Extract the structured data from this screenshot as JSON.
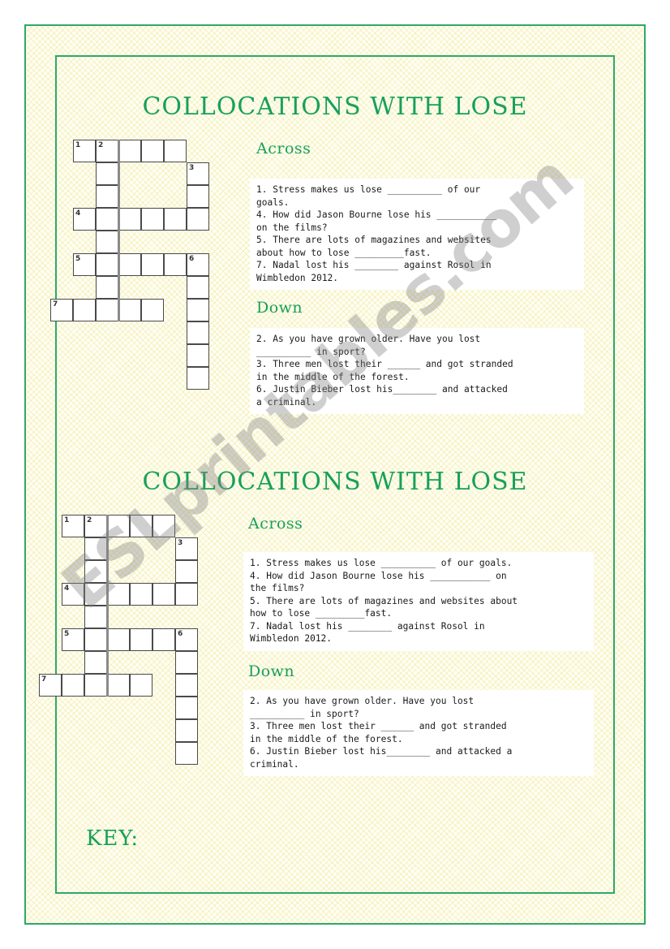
{
  "page": {
    "accent_color": "#18a05a",
    "border_color": "#2fa86b",
    "background_color": "#fffef5",
    "watermark_text": "ESLprintables.com",
    "key_label": "KEY:"
  },
  "worksheet": {
    "title": "COLLOCATIONS WITH LOSE",
    "across_heading": "Across",
    "down_heading": "Down",
    "across_clues_narrow": "1. Stress makes us lose __________ of our\ngoals.\n4. How did Jason Bourne lose his ___________\non the films?\n5. There are lots of magazines and websites\nabout how to lose _________fast.\n7. Nadal lost his ________ against Rosol in\nWimbledon 2012.",
    "down_clues_narrow": "2. As you have grown older. Have you lost\n__________ in sport?\n3. Three men lost their ______ and got stranded\nin the middle of the forest.\n6. Justin Bieber lost his________ and attacked\na criminal.",
    "across_clues_wide": "1. Stress makes us lose __________ of our goals.\n4. How did Jason Bourne lose his ___________ on\nthe films?\n5. There are lots of magazines and websites about\nhow to lose _________fast.\n7. Nadal lost his ________ against Rosol in\nWimbledon 2012.",
    "down_clues_wide": "2. As you have grown older. Have you lost\n__________ in sport?\n3. Three men lost their ______ and got stranded\nin the middle of the forest.\n6. Justin Bieber lost his________ and attacked a\ncriminal.",
    "across_items": [
      {
        "number": "1",
        "text": "Stress makes us lose __________ of our goals."
      },
      {
        "number": "4",
        "text": "How did Jason Bourne lose his ___________ on the films?"
      },
      {
        "number": "5",
        "text": "There are lots of magazines and websites about how to lose _________fast."
      },
      {
        "number": "7",
        "text": "Nadal lost his ________ against Rosol in Wimbledon 2012."
      }
    ],
    "down_items": [
      {
        "number": "2",
        "text": "As you have grown older. Have you lost __________ in sport?"
      },
      {
        "number": "3",
        "text": "Three men lost their ______ and got stranded in the middle of the forest."
      },
      {
        "number": "6",
        "text": "Justin Bieber lost his________ and attacked a criminal."
      }
    ]
  },
  "crossword": {
    "cell_size": 28,
    "columns": 8,
    "rows": 11,
    "numbers": {
      "n1": "1",
      "n2": "2",
      "n3": "3",
      "n4": "4",
      "n5": "5",
      "n6": "6",
      "n7": "7"
    },
    "cells": [
      {
        "col": 1,
        "row": 0,
        "label": "1"
      },
      {
        "col": 2,
        "row": 0,
        "label": "2"
      },
      {
        "col": 3,
        "row": 0,
        "label": ""
      },
      {
        "col": 4,
        "row": 0,
        "label": ""
      },
      {
        "col": 5,
        "row": 0,
        "label": ""
      },
      {
        "col": 2,
        "row": 1,
        "label": ""
      },
      {
        "col": 6,
        "row": 1,
        "label": "3"
      },
      {
        "col": 2,
        "row": 2,
        "label": ""
      },
      {
        "col": 6,
        "row": 2,
        "label": ""
      },
      {
        "col": 1,
        "row": 3,
        "label": "4"
      },
      {
        "col": 2,
        "row": 3,
        "label": ""
      },
      {
        "col": 3,
        "row": 3,
        "label": ""
      },
      {
        "col": 4,
        "row": 3,
        "label": ""
      },
      {
        "col": 5,
        "row": 3,
        "label": ""
      },
      {
        "col": 6,
        "row": 3,
        "label": ""
      },
      {
        "col": 2,
        "row": 4,
        "label": ""
      },
      {
        "col": 1,
        "row": 5,
        "label": "5"
      },
      {
        "col": 2,
        "row": 5,
        "label": ""
      },
      {
        "col": 3,
        "row": 5,
        "label": ""
      },
      {
        "col": 4,
        "row": 5,
        "label": ""
      },
      {
        "col": 5,
        "row": 5,
        "label": ""
      },
      {
        "col": 6,
        "row": 5,
        "label": "6"
      },
      {
        "col": 2,
        "row": 6,
        "label": ""
      },
      {
        "col": 6,
        "row": 6,
        "label": ""
      },
      {
        "col": 0,
        "row": 7,
        "label": "7"
      },
      {
        "col": 1,
        "row": 7,
        "label": ""
      },
      {
        "col": 2,
        "row": 7,
        "label": ""
      },
      {
        "col": 3,
        "row": 7,
        "label": ""
      },
      {
        "col": 4,
        "row": 7,
        "label": ""
      },
      {
        "col": 6,
        "row": 7,
        "label": ""
      },
      {
        "col": 6,
        "row": 8,
        "label": ""
      },
      {
        "col": 6,
        "row": 9,
        "label": ""
      },
      {
        "col": 6,
        "row": 10,
        "label": ""
      }
    ],
    "bars": [
      {
        "col": 3,
        "row_start": 0,
        "row_end": 8
      }
    ]
  }
}
